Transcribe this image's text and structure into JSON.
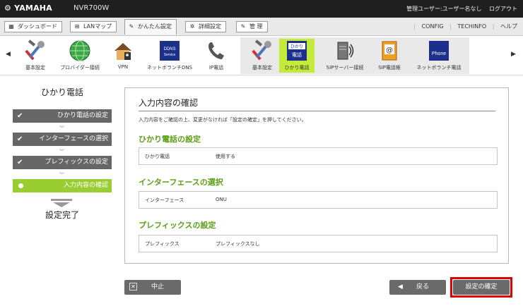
{
  "header": {
    "brand": "YAMAHA",
    "model": "NVR700W",
    "user_info": "管理ユーザー:ユーザー名なし",
    "logout": "ログアウト"
  },
  "tabs": [
    {
      "label": "ダッシュボード",
      "icon": "dashboard-icon"
    },
    {
      "label": "LANマップ",
      "icon": "lanmap-icon"
    },
    {
      "label": "かんたん設定",
      "icon": "wizard-icon",
      "active": true
    },
    {
      "label": "詳細設定",
      "icon": "gear-icon"
    },
    {
      "label": "管 理",
      "icon": "wrench-icon"
    }
  ],
  "top_links": [
    "CONFIG",
    "TECHINFO",
    "ヘルプ"
  ],
  "icon_strip": {
    "items": [
      {
        "label": "基本設定",
        "icon": "tools-icon"
      },
      {
        "label": "プロバイダー接続",
        "icon": "globe-icon"
      },
      {
        "label": "VPN",
        "icon": "vpn-house-icon"
      },
      {
        "label": "ネットボランチDNS",
        "icon": "ddns-icon",
        "pic_text": "DDNS Service"
      },
      {
        "label": "IP電話",
        "icon": "phone-icon"
      },
      {
        "label": "基本設定",
        "icon": "tools-icon"
      },
      {
        "label": "ひかり電話",
        "icon": "hikari-denwa-icon",
        "pic_text_1": "ひかり",
        "pic_text_2": "電話",
        "selected": true
      },
      {
        "label": "SIPサーバー接続",
        "icon": "sip-server-icon"
      },
      {
        "label": "SIP電話帳",
        "icon": "address-book-icon"
      },
      {
        "label": "ネットボランチ電話",
        "icon": "netvolante-phone-icon",
        "pic_text": "Phone"
      }
    ]
  },
  "sidebar": {
    "title": "ひかり電話",
    "steps": [
      {
        "label": "ひかり電話の設定"
      },
      {
        "label": "インターフェースの選択"
      },
      {
        "label": "プレフィックスの設定"
      },
      {
        "label": "入力内容の確認"
      }
    ],
    "done_label": "設定完了"
  },
  "main": {
    "title": "入力内容の確認",
    "description": "入力内容をご確認の上、変更がなければ「設定の確定」を押してください。",
    "sections": [
      {
        "title": "ひかり電話の設定",
        "key": "ひかり電話",
        "value": "使用する"
      },
      {
        "title": "インターフェースの選択",
        "key": "インターフェース",
        "value": "ONU"
      },
      {
        "title": "プレフィックスの設定",
        "key": "プレフィックス",
        "value": "プレフィックスなし"
      }
    ]
  },
  "buttons": {
    "cancel": "中止",
    "back": "戻る",
    "confirm": "設定の確定"
  },
  "colors": {
    "accent_green": "#9acd32",
    "section_green": "#5a9e12",
    "highlight_red": "#e00000",
    "topbar": "#1f1f1f"
  }
}
